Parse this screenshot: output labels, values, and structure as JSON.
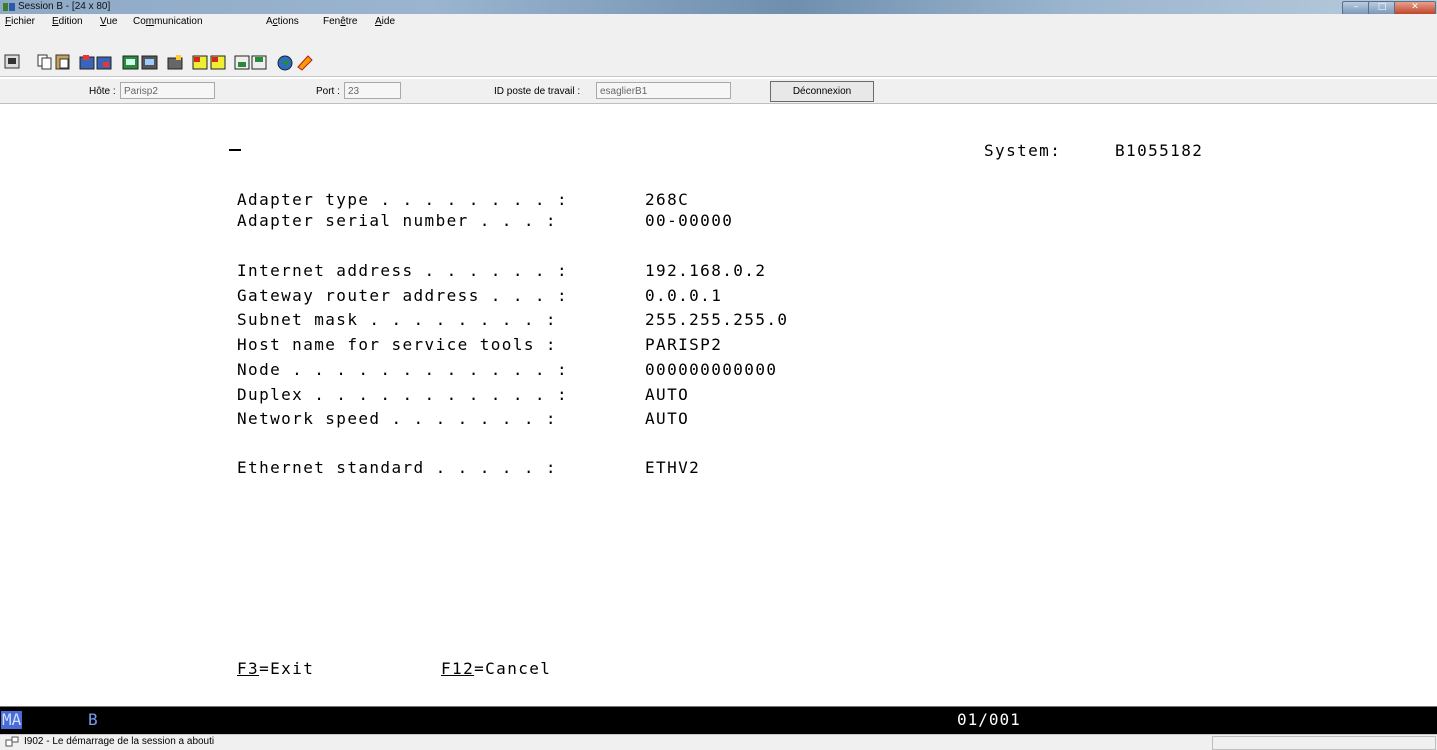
{
  "window": {
    "title": "Session B - [24 x 80]"
  },
  "menu": [
    {
      "pre": "",
      "u": "F",
      "post": "ichier"
    },
    {
      "pre": "",
      "u": "E",
      "post": "dition"
    },
    {
      "pre": "",
      "u": "V",
      "post": "ue"
    },
    {
      "pre": "Co",
      "u": "m",
      "post": "munication"
    },
    {
      "pre": "A",
      "u": "c",
      "post": "tions"
    },
    {
      "pre": "Fen",
      "u": "ê",
      "post": "tre"
    },
    {
      "pre": "",
      "u": "A",
      "post": "ide"
    }
  ],
  "connection": {
    "host_label": "Hôte :",
    "host_value": "Parisp2",
    "port_label": "Port :",
    "port_value": "23",
    "wsid_label": "ID poste de travail :",
    "wsid_value": "esaglierB1",
    "disconnect_label": "Déconnexion"
  },
  "terminal": {
    "system_label": "System:",
    "system_value": "B1055182",
    "fields": [
      {
        "label": "Adapter type . . . . . . . . :",
        "value": "268C"
      },
      {
        "label": "Adapter serial number . . . :",
        "value": "00-00000"
      },
      {
        "label": "Internet address . . . . . . :",
        "value": "192.168.0.2"
      },
      {
        "label": "Gateway router address . . . :",
        "value": "0.0.0.1"
      },
      {
        "label": "Subnet mask . . . . . . . . :",
        "value": "255.255.255.0"
      },
      {
        "label": "Host name for service tools :",
        "value": "PARISP2"
      },
      {
        "label": "Node . . . . . . . . . . . . :",
        "value": "000000000000"
      },
      {
        "label": "Duplex . . . . . . . . . . . :",
        "value": "AUTO"
      },
      {
        "label": "Network speed . . . . . . . :",
        "value": "AUTO"
      },
      {
        "label": "Ethernet standard . . . . . :",
        "value": "ETHV2"
      }
    ],
    "fkeys": [
      {
        "key": "F3",
        "action": "=Exit"
      },
      {
        "key": "F12",
        "action": "=Cancel"
      }
    ]
  },
  "oia": {
    "mode": "MA",
    "session": "B",
    "cursor_pos": "01/001"
  },
  "status": {
    "message": "I902 - Le démarrage de la session a abouti"
  },
  "colors": {
    "oia_bg": "#000000",
    "oia_text": "#7b9cf5",
    "screen_bg": "#ffffff"
  }
}
